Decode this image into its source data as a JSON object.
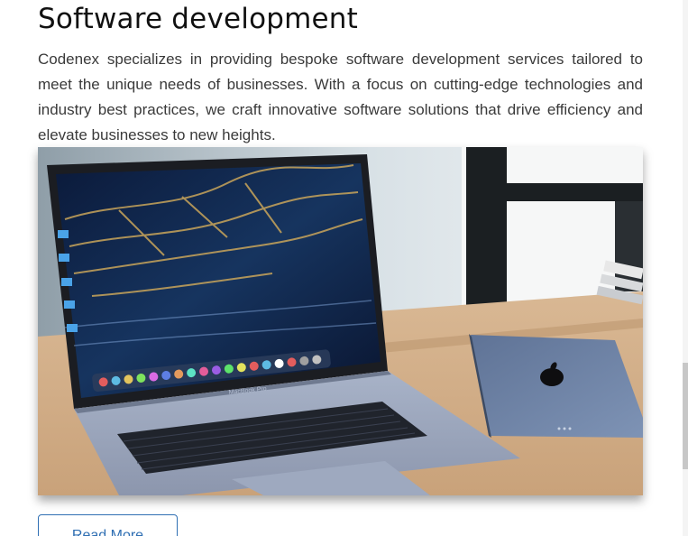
{
  "section": {
    "title": "Software development",
    "description": "Codenex specializes in providing bespoke software development services tailored to meet the unique needs of businesses. With a focus on cutting-edge technologies and industry best practices, we craft innovative software solutions that drive efficiency and elevate businesses to new heights.",
    "read_more_label": "Read More"
  },
  "image": {
    "laptop_label": "MacBook Pro",
    "tablet_logo": "apple-logo"
  },
  "colors": {
    "button_accent": "#2f6fb3",
    "title": "#111111",
    "body_text": "#3a3a3a"
  }
}
